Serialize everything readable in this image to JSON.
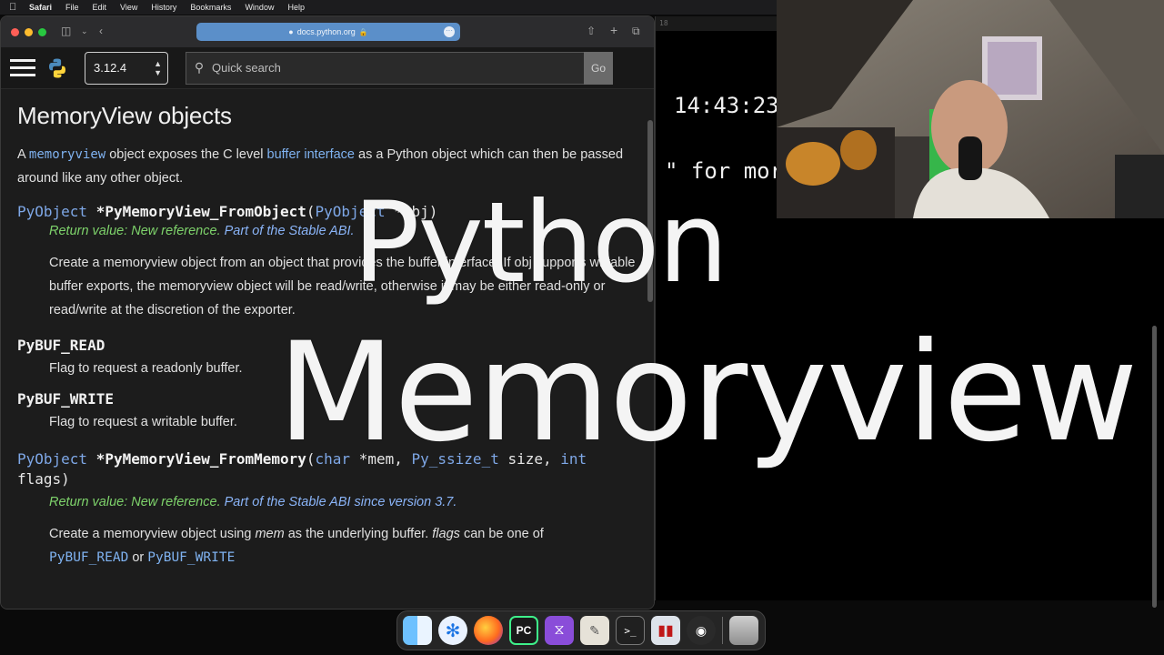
{
  "menubar": {
    "app": "Safari",
    "items": [
      "File",
      "Edit",
      "View",
      "History",
      "Bookmarks",
      "Window",
      "Help"
    ]
  },
  "browser": {
    "url": "docs.python.org",
    "lock": "lock-icon"
  },
  "docbar": {
    "version": "3.12.4",
    "search_placeholder": "Quick search",
    "go": "Go"
  },
  "doc": {
    "title": "MemoryView objects",
    "intro_pre": "A ",
    "intro_link1": "memoryview",
    "intro_mid": " object exposes the C level ",
    "intro_link2": "buffer interface",
    "intro_post": " as a Python object which can then be passed around like any other object.",
    "fn1": {
      "ret_type": "PyObject",
      "name": "*PyMemoryView_FromObject",
      "open": "(",
      "param_type": "PyObject",
      "param": " *obj",
      "close": ")"
    },
    "note1_green": "Return value: New reference.",
    "note1_blue": " Part of the Stable ABI.",
    "desc1": "Create a memoryview object from an object that provides the buffer interface. If obj supports writable buffer exports, the memoryview object will be read/write, otherwise it may be either read-only or read/write at the discretion of the exporter.",
    "const1": "PyBUF_READ",
    "const1_desc": "Flag to request a readonly buffer.",
    "const2": "PyBUF_WRITE",
    "const2_desc": "Flag to request a writable buffer.",
    "fn2": {
      "ret_type": "PyObject",
      "name": "*PyMemoryView_FromMemory",
      "open": "(",
      "t1": "char",
      "p1": " *mem, ",
      "t2": "Py_ssize_t",
      "p2": " size, ",
      "t3": "int",
      "p3": " flags",
      "close": ")"
    },
    "note2_green": "Return value: New reference.",
    "note2_blue": " Part of the Stable ABI since version 3.7.",
    "desc2_pre": "Create a memoryview object using ",
    "desc2_em1": "mem",
    "desc2_mid": " as the underlying buffer. ",
    "desc2_em2": "flags",
    "desc2_post": " can be one of",
    "desc2_next_a": "PyBUF_READ",
    "desc2_next_or": " or ",
    "desc2_next_b": "PyBUF_WRITE"
  },
  "terminal": {
    "clock": "14:43:23",
    "line": "\" for mor",
    "tab_hint": "18"
  },
  "overlay": {
    "line1": "Python",
    "line2": "Memoryview"
  },
  "dock": {
    "apps": [
      "finder-icon",
      "safari-icon",
      "firefox-icon",
      "pycharm-icon",
      "visual-studio-icon",
      "gimp-icon",
      "terminal-icon",
      "activity-monitor-icon",
      "obs-icon",
      "trash-icon"
    ]
  },
  "colors": {
    "link": "#7fb2f0",
    "note_green": "#7ed36b",
    "note_blue": "#8ab4f8",
    "url_bar": "#5b8fc9"
  }
}
